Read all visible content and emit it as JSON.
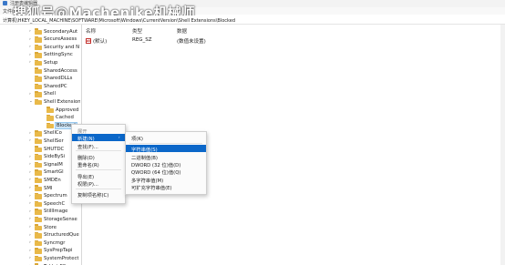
{
  "window": {
    "title": "注册表编辑器",
    "menu": [
      "文件(F)",
      "编辑(E)",
      "查看(V)",
      "收藏夹(A)",
      "帮助(H)"
    ]
  },
  "watermark": "搜狐号@Machenike机械师",
  "address": "计算机\\HKEY_LOCAL_MACHINE\\SOFTWARE\\Microsoft\\Windows\\CurrentVersion\\Shell Extensions\\Blocked",
  "tree": [
    {
      "label": "SecondaryAut",
      "arrow": "›",
      "indent": 0
    },
    {
      "label": "SecureAssess",
      "arrow": "›",
      "indent": 0
    },
    {
      "label": "Security and N",
      "arrow": "›",
      "indent": 0
    },
    {
      "label": "SettingSync",
      "arrow": "›",
      "indent": 0
    },
    {
      "label": "Setup",
      "arrow": "›",
      "indent": 0
    },
    {
      "label": "SharedAccess",
      "arrow": "",
      "indent": 0
    },
    {
      "label": "SharedDLLs",
      "arrow": "",
      "indent": 0
    },
    {
      "label": "SharedPC",
      "arrow": "",
      "indent": 0
    },
    {
      "label": "Shell",
      "arrow": "›",
      "indent": 0
    },
    {
      "label": "Shell Extension",
      "arrow": "⌄",
      "indent": 0
    },
    {
      "label": "Approved",
      "arrow": "",
      "indent": 1
    },
    {
      "label": "Cached",
      "arrow": "",
      "indent": 1
    },
    {
      "label": "Blocked",
      "arrow": "",
      "indent": 1,
      "selected": true
    },
    {
      "label": "ShellCo",
      "arrow": "›",
      "indent": 0
    },
    {
      "label": "ShellSer",
      "arrow": "›",
      "indent": 0
    },
    {
      "label": "SHUTDC",
      "arrow": "",
      "indent": 0
    },
    {
      "label": "SideBySi",
      "arrow": "›",
      "indent": 0
    },
    {
      "label": "SignalM",
      "arrow": "›",
      "indent": 0
    },
    {
      "label": "SmartGl",
      "arrow": "›",
      "indent": 0
    },
    {
      "label": "SMDEn",
      "arrow": "›",
      "indent": 0
    },
    {
      "label": "SMI",
      "arrow": "›",
      "indent": 0
    },
    {
      "label": "Spectrum",
      "arrow": "›",
      "indent": 0
    },
    {
      "label": "SpeechC",
      "arrow": "›",
      "indent": 0
    },
    {
      "label": "StillImage",
      "arrow": "›",
      "indent": 0
    },
    {
      "label": "StorageSense",
      "arrow": "›",
      "indent": 0
    },
    {
      "label": "Store",
      "arrow": "›",
      "indent": 0
    },
    {
      "label": "StructuredQue",
      "arrow": "›",
      "indent": 0
    },
    {
      "label": "Syncmgr",
      "arrow": "›",
      "indent": 0
    },
    {
      "label": "SysPrepTapi",
      "arrow": "›",
      "indent": 0
    },
    {
      "label": "SystemProtect",
      "arrow": "›",
      "indent": 0
    },
    {
      "label": "Tablet PC",
      "arrow": "›",
      "indent": 0
    }
  ],
  "values": {
    "headers": {
      "name": "名称",
      "type": "类型",
      "data": "数据"
    },
    "rows": [
      {
        "name": "(默认)",
        "type": "REG_SZ",
        "data": "(数值未设置)"
      }
    ]
  },
  "context_menu": {
    "items": [
      {
        "label": "展开",
        "muted": true
      },
      {
        "label": "新建(N)",
        "highlight": true,
        "submenu": true
      },
      {
        "label": "查找(F)..."
      },
      {
        "sep": true
      },
      {
        "label": "删除(D)"
      },
      {
        "label": "重命名(R)"
      },
      {
        "sep": true
      },
      {
        "label": "导出(E)"
      },
      {
        "label": "权限(P)..."
      },
      {
        "sep": true
      },
      {
        "label": "复制项名称(C)"
      }
    ]
  },
  "submenu": {
    "items": [
      {
        "label": "项(K)"
      },
      {
        "sep": true
      },
      {
        "label": "字符串值(S)",
        "highlight": true
      },
      {
        "label": "二进制值(B)"
      },
      {
        "label": "DWORD (32 位)值(D)"
      },
      {
        "label": "QWORD (64 位)值(Q)"
      },
      {
        "label": "多字符串值(M)"
      },
      {
        "label": "可扩充字符串值(E)"
      }
    ]
  },
  "colors": {
    "highlight": "#0b67c9",
    "selection": "#cce4f7",
    "folder": "#e9b949"
  }
}
